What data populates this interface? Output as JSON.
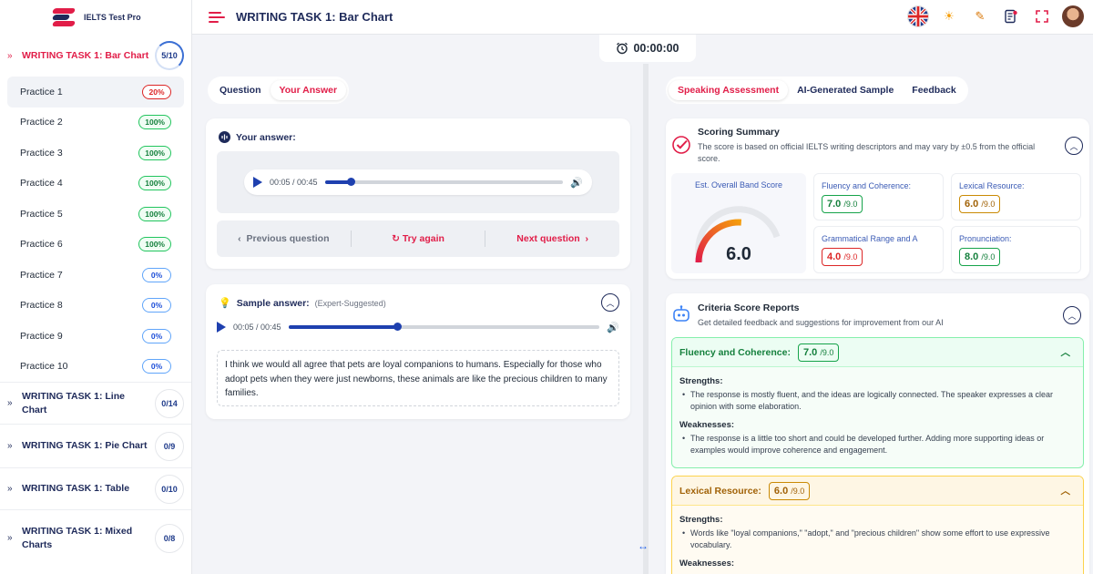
{
  "brand": {
    "name": "IELTS Test Pro",
    "accent": "#e11d48",
    "navy": "#1e2a5a"
  },
  "header": {
    "title": "WRITING TASK 1: Bar Chart",
    "icons": [
      "flag-uk-icon",
      "sun-icon",
      "pencil-icon",
      "notes-icon",
      "fullscreen-icon",
      "avatar"
    ]
  },
  "timer": {
    "value": "00:00:00"
  },
  "sidebar": {
    "active_group": {
      "title": "WRITING TASK 1: Bar Chart",
      "progress": "5/10",
      "progress_fraction": 0.5
    },
    "practices": [
      {
        "label": "Practice 1",
        "score": "20%",
        "state": "red"
      },
      {
        "label": "Practice 2",
        "score": "100%",
        "state": "green"
      },
      {
        "label": "Practice 3",
        "score": "100%",
        "state": "green"
      },
      {
        "label": "Practice 4",
        "score": "100%",
        "state": "green"
      },
      {
        "label": "Practice 5",
        "score": "100%",
        "state": "green"
      },
      {
        "label": "Practice 6",
        "score": "100%",
        "state": "green"
      },
      {
        "label": "Practice 7",
        "score": "0%",
        "state": "blue"
      },
      {
        "label": "Practice 8",
        "score": "0%",
        "state": "blue"
      },
      {
        "label": "Practice 9",
        "score": "0%",
        "state": "blue"
      },
      {
        "label": "Practice 10",
        "score": "0%",
        "state": "blue"
      }
    ],
    "groups": [
      {
        "title": "WRITING TASK 1: Line Chart",
        "progress": "0/14"
      },
      {
        "title": "WRITING TASK 1: Pie Chart",
        "progress": "0/9"
      },
      {
        "title": "WRITING TASK 1: Table",
        "progress": "0/10"
      },
      {
        "title": "WRITING TASK 1: Mixed Charts",
        "progress": "0/8"
      }
    ]
  },
  "left": {
    "tabs": [
      "Question",
      "Your Answer"
    ],
    "answer": {
      "label": "Your answer:",
      "audio": {
        "time": "00:05 / 00:45",
        "progress": 0.11
      },
      "prev": "Previous question",
      "retry": "Try again",
      "next": "Next question"
    },
    "sample": {
      "label": "Sample answer:",
      "hint": "(Expert-Suggested)",
      "audio": {
        "time": "00:05 / 00:45",
        "progress": 0.35
      },
      "text": "I think we would all agree that pets are loyal companions to humans. Especially for those who adopt pets when they were just newborns, these animals are like the precious children to many families."
    }
  },
  "right": {
    "tabs": [
      "Speaking Assessment",
      "AI-Generated Sample",
      "Feedback"
    ],
    "summary": {
      "title": "Scoring Summary",
      "desc": "The score is based on official IELTS writing descriptors and may vary by ±0.5 from the official score.",
      "overall_label": "Est. Overall Band Score",
      "overall": "6.0",
      "overall_value": 6.0,
      "scores": [
        {
          "label": "Fluency and Coherence:",
          "value": "7.0",
          "max": "/9.0",
          "tone": "green"
        },
        {
          "label": "Lexical Resource:",
          "value": "6.0",
          "max": "/9.0",
          "tone": "orange"
        },
        {
          "label": "Grammatical Range and A",
          "value": "4.0",
          "max": "/9.0",
          "tone": "red"
        },
        {
          "label": "Pronunciation:",
          "value": "8.0",
          "max": "/9.0",
          "tone": "green"
        }
      ]
    },
    "criteria": {
      "title": "Criteria Score Reports",
      "desc": "Get detailed feedback and suggestions for improvement from our AI",
      "fluency": {
        "label": "Fluency and Coherence:",
        "value": "7.0",
        "max": "/9.0",
        "strengths_label": "Strengths:",
        "strength": "The response is mostly fluent, and the ideas are logically connected. The speaker expresses a clear opinion with some elaboration.",
        "weaknesses_label": "Weaknesses:",
        "weakness": "The response is a little too short and could be developed further. Adding more supporting ideas or examples would improve coherence and engagement."
      },
      "lexical": {
        "label": "Lexical Resource:",
        "value": "6.0",
        "max": "/9.0",
        "strengths_label": "Strengths:",
        "strength": "Words like \"loyal companions,\" \"adopt,\" and \"precious children\" show some effort to use expressive vocabulary.",
        "weaknesses_label": "Weaknesses:"
      }
    }
  }
}
